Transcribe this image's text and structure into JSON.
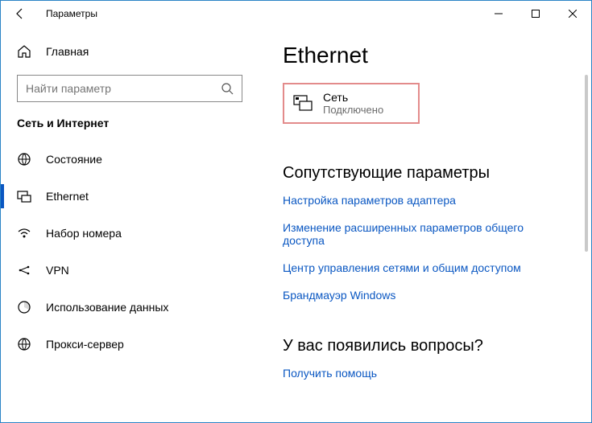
{
  "titlebar": {
    "title": "Параметры"
  },
  "sidebar": {
    "home_label": "Главная",
    "search_placeholder": "Найти параметр",
    "section_header": "Сеть и Интернет",
    "items": [
      {
        "label": "Состояние"
      },
      {
        "label": "Ethernet"
      },
      {
        "label": "Набор номера"
      },
      {
        "label": "VPN"
      },
      {
        "label": "Использование данных"
      },
      {
        "label": "Прокси-сервер"
      }
    ]
  },
  "main": {
    "heading": "Ethernet",
    "network_tile": {
      "name": "Сеть",
      "status": "Подключено"
    },
    "related_heading": "Сопутствующие параметры",
    "related_links": [
      "Настройка параметров адаптера",
      "Изменение расширенных параметров общего доступа",
      "Центр управления сетями и общим доступом",
      "Брандмауэр Windows"
    ],
    "help_heading": "У вас появились вопросы?",
    "help_link": "Получить помощь"
  }
}
